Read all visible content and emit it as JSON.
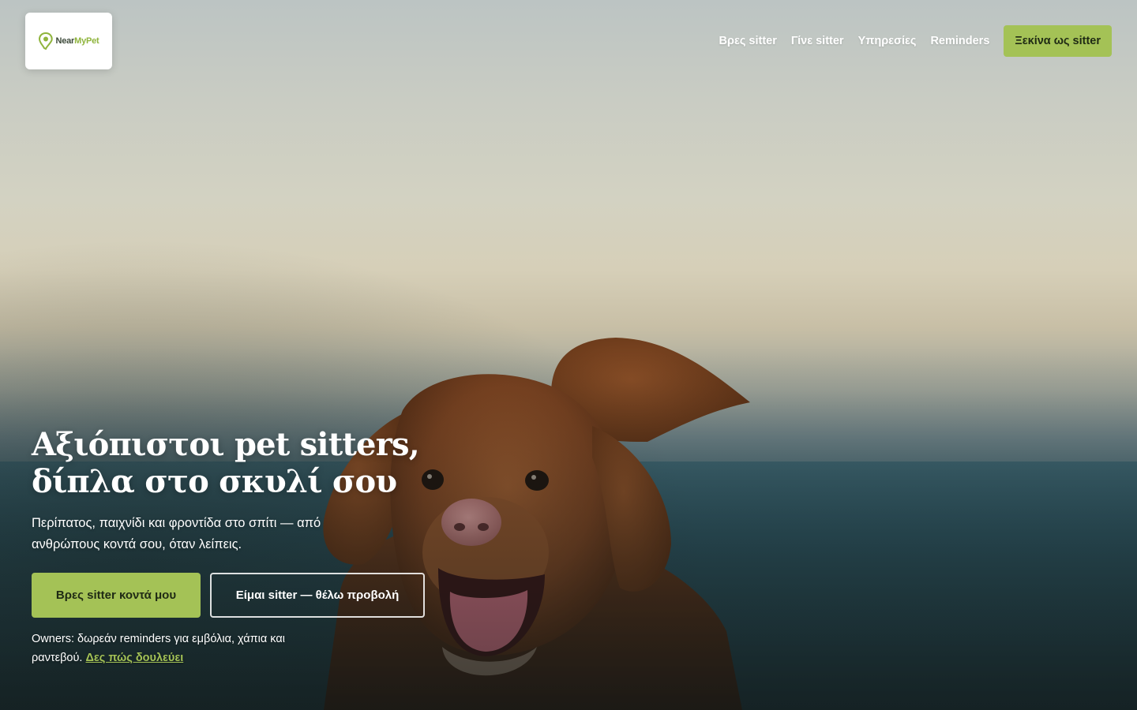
{
  "brand": {
    "logo_text_a": "Near",
    "logo_text_b": "MyPet",
    "logo_icon": "location-pin-icon",
    "accent_color": "#a4c256"
  },
  "nav": {
    "items": [
      {
        "label": "Βρες sitter"
      },
      {
        "label": "Γίνε sitter"
      },
      {
        "label": "Υπηρεσίες"
      },
      {
        "label": "Reminders"
      }
    ],
    "cta_label": "Ξεκίνα ως sitter"
  },
  "hero": {
    "headline_line1": "Αξιόπιστοι pet sitters,",
    "headline_line2": "δίπλα στο σκυλί σου",
    "subtitle": "Περίπατος, παιχνίδι και φροντίδα στο σπίτι — από ανθρώπους κοντά σου, όταν λείπεις.",
    "primary_button": "Βρες sitter κοντά μου",
    "secondary_button": "Είμαι sitter — θέλω προβολή",
    "owners_note": "Owners: δωρεάν reminders για εμβόλια, χάπια και ραντεβού.",
    "owners_link": "Δες πώς δουλεύει"
  }
}
